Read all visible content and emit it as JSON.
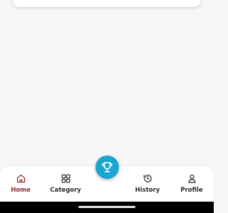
{
  "colors": {
    "background": "#f8f6f9",
    "surface": "#ffffff",
    "active": "#8f2a2a",
    "inactive": "#2b2b2b",
    "fab": "#1aa6cf",
    "system_bar": "#000000"
  },
  "bottom_nav": {
    "items": [
      {
        "label": "Home",
        "icon": "home-icon",
        "active": true
      },
      {
        "label": "Category",
        "icon": "grid-icon",
        "active": false
      },
      {
        "label": "History",
        "icon": "history-icon",
        "active": false
      },
      {
        "label": "Profile",
        "icon": "person-icon",
        "active": false
      }
    ],
    "fab": {
      "icon": "trophy-icon"
    }
  }
}
